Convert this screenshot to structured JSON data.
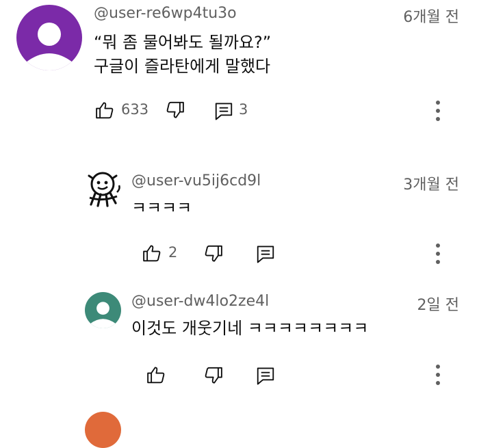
{
  "colors": {
    "avatar_1": "#7b2aa8",
    "avatar_3": "#3d8a78",
    "avatar_4": "#e06a3a",
    "meta_gray": "#606060",
    "text": "#0f0f0f"
  },
  "comments": [
    {
      "handle": "@user-re6wp4tu3o",
      "time": "6개월 전",
      "lines": [
        "“뭐 좀 물어봐도 될까요?”",
        "구글이 즐라탄에게 말했다"
      ],
      "likes": "633",
      "replies": "3"
    },
    {
      "handle": "@user-vu5ij6cd9l",
      "time": "3개월 전",
      "lines": [
        "ㅋㅋㅋㅋ"
      ],
      "likes": "2"
    },
    {
      "handle": "@user-dw4lo2ze4l",
      "time": "2일 전",
      "lines": [
        "이것도 개웃기네 ㅋㅋㅋㅋㅋㅋㅋㅋ"
      ]
    }
  ],
  "icons": {
    "like": "thumbs-up-icon",
    "dislike": "thumbs-down-icon",
    "reply": "comment-icon",
    "more": "more-vert-icon"
  }
}
